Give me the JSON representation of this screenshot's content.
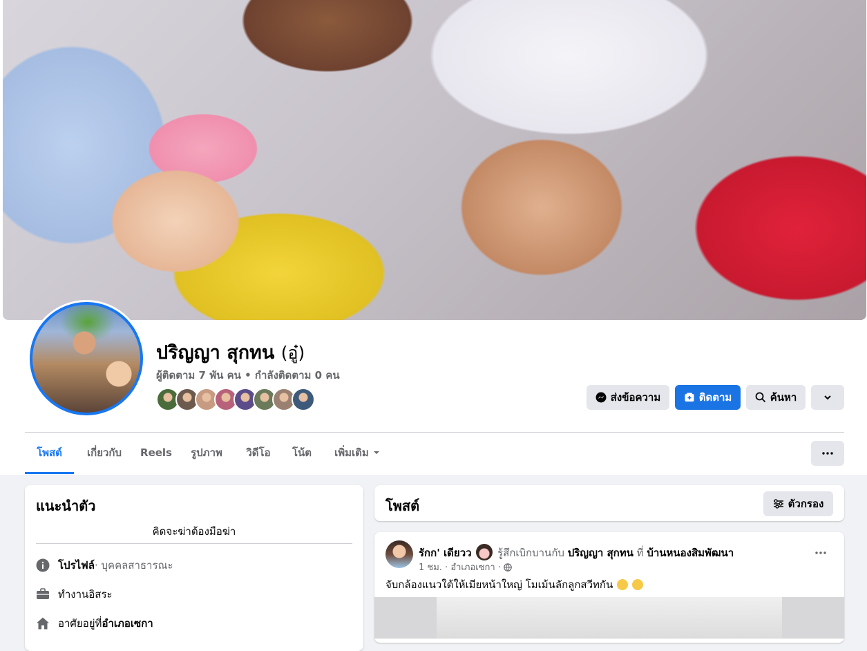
{
  "profile": {
    "name": "ปริญญา สุกทน",
    "alt_name": "(อู๋)",
    "stats": "ผู้ติดตาม 7 พัน คน • กำลังติดตาม 0 คน",
    "friend_avatar_colors": [
      "#4a6b3a",
      "#6d5a4e",
      "#c79b82",
      "#b7627a",
      "#5c4c8a",
      "#6a7a5a",
      "#9a8070",
      "#3e5a7a"
    ]
  },
  "actions": {
    "message": "ส่งข้อความ",
    "follow": "ติดตาม",
    "search": "ค้นหา"
  },
  "tabs": [
    "โพสต์",
    "เกี่ยวกับ",
    "Reels",
    "รูปภาพ",
    "วิดีโอ",
    "โน้ต",
    "เพิ่มเติม"
  ],
  "active_tab": "โพสต์",
  "intro": {
    "title": "แนะนำตัว",
    "bio": "คิดจะฆ่าต้องมือฆ่า",
    "items": [
      {
        "icon": "info-icon",
        "label": "โปรไฟล์",
        "detail": " · บุคคลสาธารณะ"
      },
      {
        "icon": "briefcase-icon",
        "label": "ทำงานอิสระ",
        "detail": ""
      },
      {
        "icon": "home-icon",
        "label": "อาศัยอยู่ที่ ",
        "detail": "อำเภอเซกา"
      }
    ]
  },
  "posts": {
    "title": "โพสต์",
    "filter_label": "ตัวกรอง",
    "post": {
      "author": "รักก' เดียวว",
      "feeling_text": "รู้สึกเบิกบานกับ",
      "tagged": "ปริญญา สุกทน",
      "at_word": "ที่",
      "place": "บ้านหนองสิมพัฒนา",
      "time": "1 ชม. · อำเภอเซกา ·",
      "text": "จับกล้องแนวใต้ให้เมียหน้าใหญ่ โมเม้นลักลูกสวีทกัน"
    }
  },
  "colors": {
    "accent": "#1877f2",
    "button_grey": "#e4e6eb",
    "muted_text": "#65676b",
    "page_bg": "#f0f2f5"
  }
}
